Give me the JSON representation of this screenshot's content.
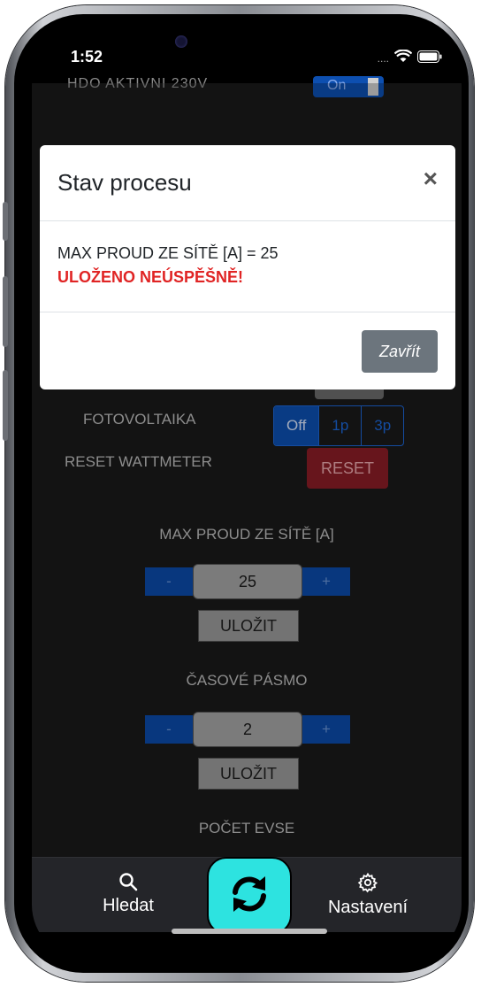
{
  "status_bar": {
    "time": "1:52",
    "signal": "....",
    "icons": [
      "wifi-icon",
      "battery-icon"
    ]
  },
  "background": {
    "partial_label": "HDO AKTIVNI 230V",
    "partial_toggle": "On",
    "pv": {
      "label": "FOTOVOLTAIKA",
      "options": [
        "Off",
        "1p",
        "3p"
      ],
      "selected": "Off"
    },
    "reset": {
      "label": "RESET WATTMETER",
      "button": "RESET"
    },
    "max_current": {
      "label": "MAX PROUD ZE SÍTĚ [A]",
      "minus": "-",
      "value": "25",
      "plus": "+",
      "save": "ULOŽIT"
    },
    "timezone": {
      "label": "ČASOVÉ PÁSMO",
      "minus": "-",
      "value": "2",
      "plus": "+",
      "save": "ULOŽIT"
    },
    "evse_count": {
      "label": "POČET EVSE"
    }
  },
  "modal": {
    "title": "Stav procesu",
    "close_symbol": "×",
    "message": "MAX PROUD ZE SÍTĚ [A] = 25",
    "error": "ULOŽENO NEÚSPĚŠNĚ!",
    "close_button": "Zavřít"
  },
  "tabbar": {
    "search": {
      "label": "Hledat",
      "icon": "search-icon"
    },
    "refresh": {
      "icon": "refresh-icon"
    },
    "settings": {
      "label": "Nastavení",
      "icon": "gear-icon"
    }
  },
  "colors": {
    "accent": "#0d4fb0",
    "danger": "#e02424",
    "refresh": "#2de3e0",
    "secondary": "#6c757d"
  }
}
